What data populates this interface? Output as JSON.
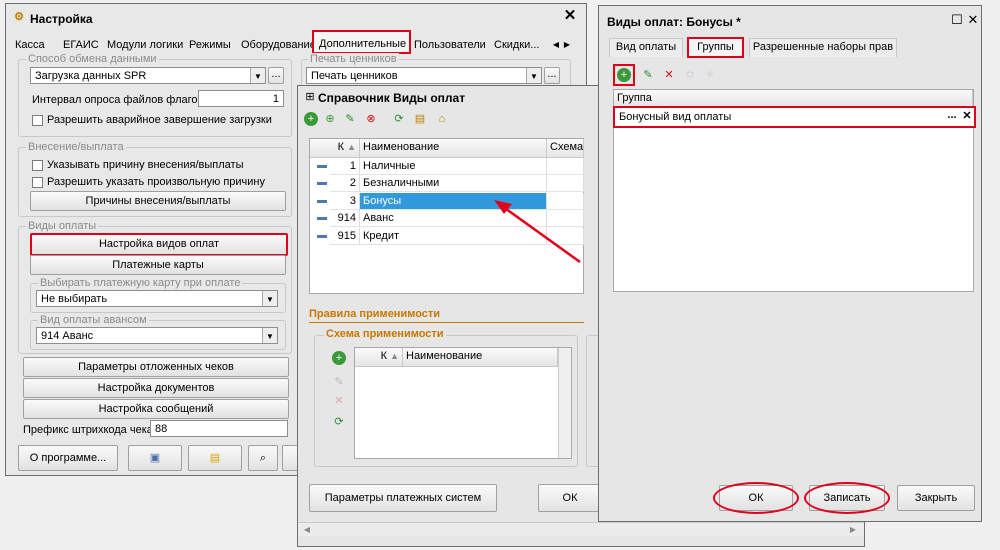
{
  "settings": {
    "title": "Настройка",
    "tabs": [
      "Касса",
      "ЕГАИС",
      "Модули логики",
      "Режимы",
      "Оборудование",
      "Дополнительные",
      "Пользователи",
      "Скидки..."
    ],
    "exchange_group": "Способ обмена данными",
    "exchange_value": "Загрузка данных SPR",
    "poll_label": "Интервал опроса файлов флагов:",
    "poll_value": "1",
    "emergency_label": "Разрешить аварийное завершение загрузки",
    "price_print_group": "Печать ценников",
    "price_print_value": "Печать ценников",
    "cash_group": "Внесение/выплата",
    "cash_reason_label": "Указывать причину внесения/выплаты",
    "cash_free_label": "Разрешить указать произвольную причину",
    "cash_reasons_button": "Причины внесения/выплаты",
    "payment_group": "Виды оплаты",
    "payment_settings_button": "Настройка видов оплат",
    "payment_cards_button": "Платежные карты",
    "choose_card_group": "Выбирать платежную карту при оплате",
    "choose_card_value": "Не выбирать",
    "advance_group": "Вид оплаты авансом",
    "advance_value": "914 Аванс",
    "deferred_button": "Параметры отложенных чеков",
    "docs_button": "Настройка документов",
    "messages_button": "Настройка сообщений",
    "barcode_label": "Префикс штрихкода чека:",
    "barcode_value": "88",
    "about_button": "О программе..."
  },
  "catalog": {
    "title": "Справочник Виды оплат",
    "col_k": "К",
    "col_name": "Наименование",
    "col_scheme": "Схема при",
    "rows": [
      {
        "code": "1",
        "name": "Наличные"
      },
      {
        "code": "2",
        "name": "Безналичными"
      },
      {
        "code": "3",
        "name": "Бонусы"
      },
      {
        "code": "914",
        "name": "Аванс"
      },
      {
        "code": "915",
        "name": "Кредит"
      }
    ],
    "rules_group": "Правила применимости",
    "scheme_group": "Схема применимости",
    "scheme_col_k": "К",
    "scheme_col_name": "Наименование",
    "payment_systems_button": "Параметры платежных систем",
    "ok_button": "ОК"
  },
  "bonus": {
    "title": "Виды оплат: Бонусы *",
    "tabs": [
      "Вид оплаты",
      "Группы",
      "Разрешенные наборы прав"
    ],
    "col_group": "Группа",
    "group_value": "Бонусный вид оплаты",
    "ok_button": "ОК",
    "save_button": "Записать",
    "close_button": "Закрыть"
  },
  "colors": {
    "highlight_red": "#e0001b",
    "selection_blue": "#3399dd",
    "group_title_orange": "#c87800"
  }
}
